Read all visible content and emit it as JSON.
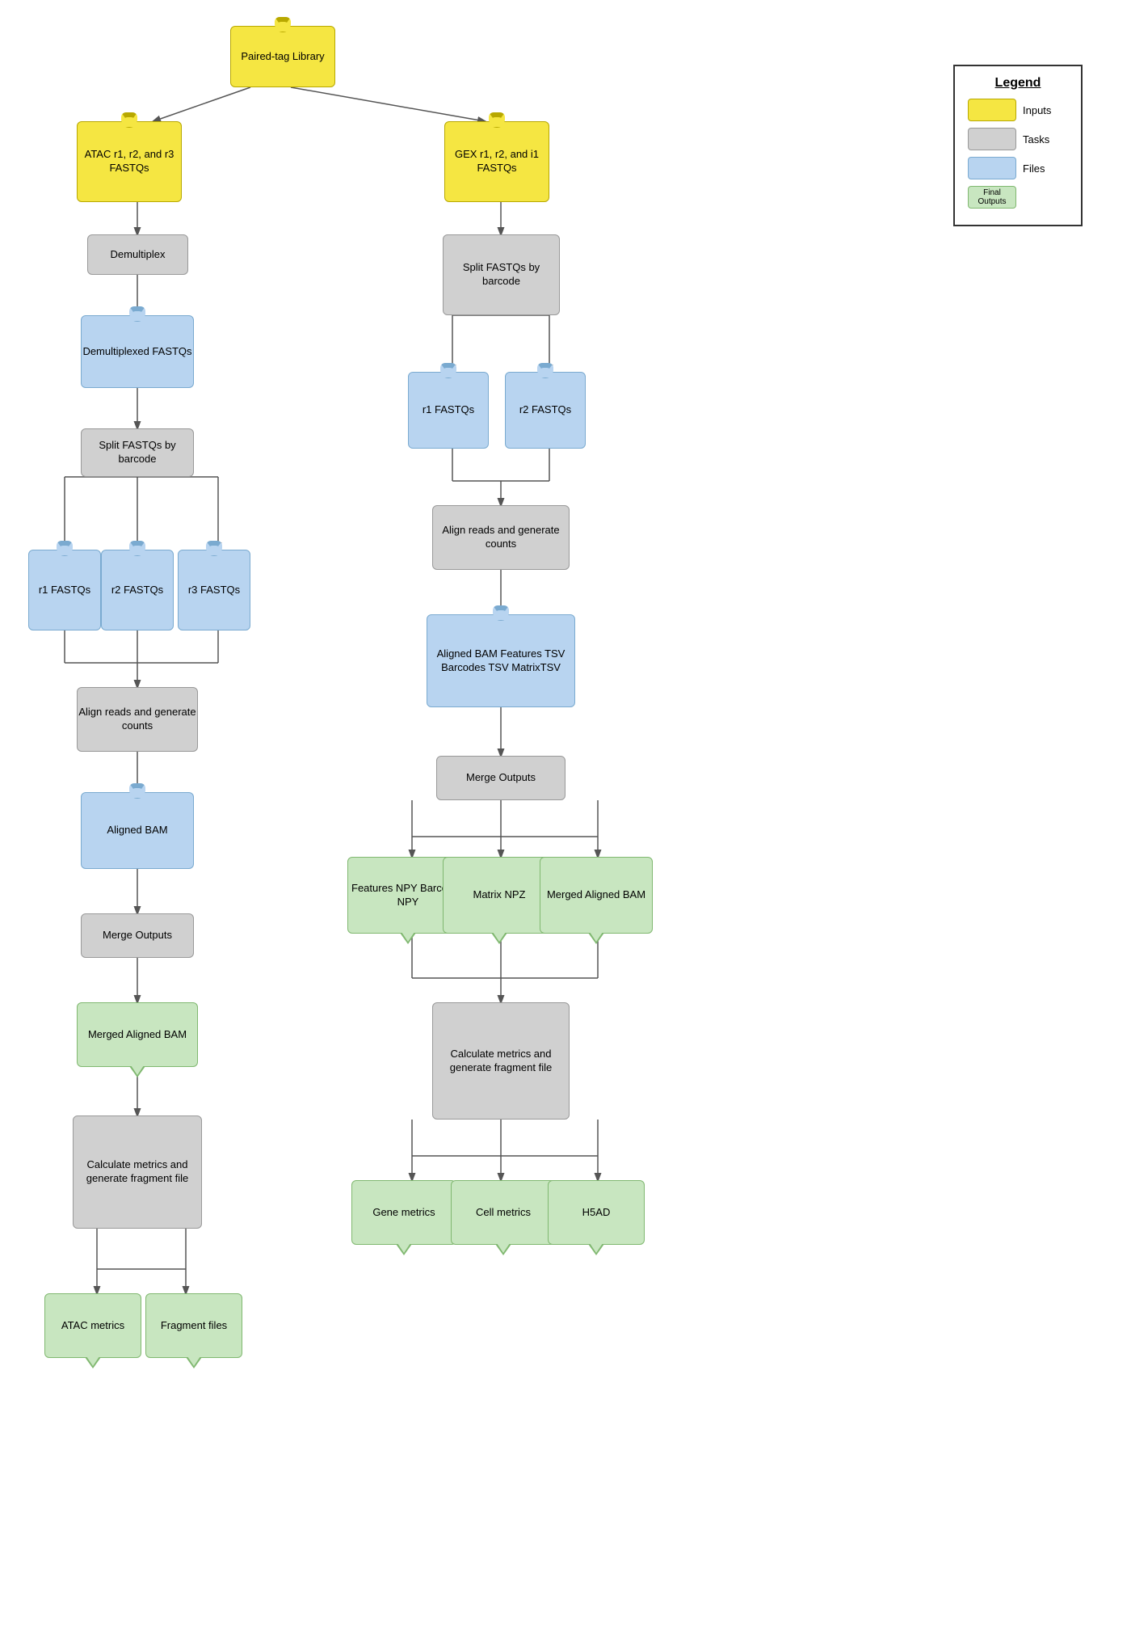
{
  "legend": {
    "title": "Legend",
    "items": [
      {
        "label": "Inputs",
        "color": "#f5e642",
        "border": "#b8a800"
      },
      {
        "label": "Tasks",
        "color": "#d0d0d0",
        "border": "#999999"
      },
      {
        "label": "Files",
        "color": "#b8d4f0",
        "border": "#7aaad0"
      },
      {
        "label": "Final Outputs",
        "color": "#c8e6c0",
        "border": "#80b870"
      }
    ]
  },
  "nodes": {
    "paired_tag": "Paired-tag\nLibrary",
    "atac_fastqs": "ATAC r1, r2,\nand r3\nFASTQs",
    "gex_fastqs": "GEX  r1, r2,\nand i1\nFASTQs",
    "demultiplex": "Demultiplex",
    "demux_fastqs": "Demultiplexed\nFASTQs",
    "split_left": "Split FASTQs\nby barcode",
    "split_right": "Split FASTQs\nby barcode",
    "r1_left": "r1\nFASTQs",
    "r2_left": "r2\nFASTQs",
    "r3_left": "r3\nFASTQs",
    "r1_right": "r1\nFASTQs",
    "r2_right": "r2\nFASTQs",
    "align_left": "Align reads and generate\ncounts",
    "align_right": "Align reads and generate\ncounts",
    "aligned_bam_left": "Aligned BAM",
    "aligned_bam_right": "Aligned BAM\nFeatures TSV\nBarcodes TSV\nMatrixTSV",
    "merge_left": "Merge Outputs",
    "merge_right": "Merge Outputs",
    "merged_bam_left": "Merged Aligned\nBAM",
    "features_npy": "Features NPY\nBarcodes NPY",
    "matrix_npz": "Matrix NPZ",
    "merged_bam_right": "Merged\nAligned BAM",
    "calc_left": "Calculate metrics\nand generate\nfragment file",
    "calc_right": "Calculate metrics\nand generate\nfragment file",
    "atac_metrics": "ATAC\nmetrics",
    "fragment_files": "Fragment\nfiles",
    "gene_metrics": "Gene\nmetrics",
    "cell_metrics": "Cell\nmetrics",
    "h5ad": "H5AD"
  }
}
